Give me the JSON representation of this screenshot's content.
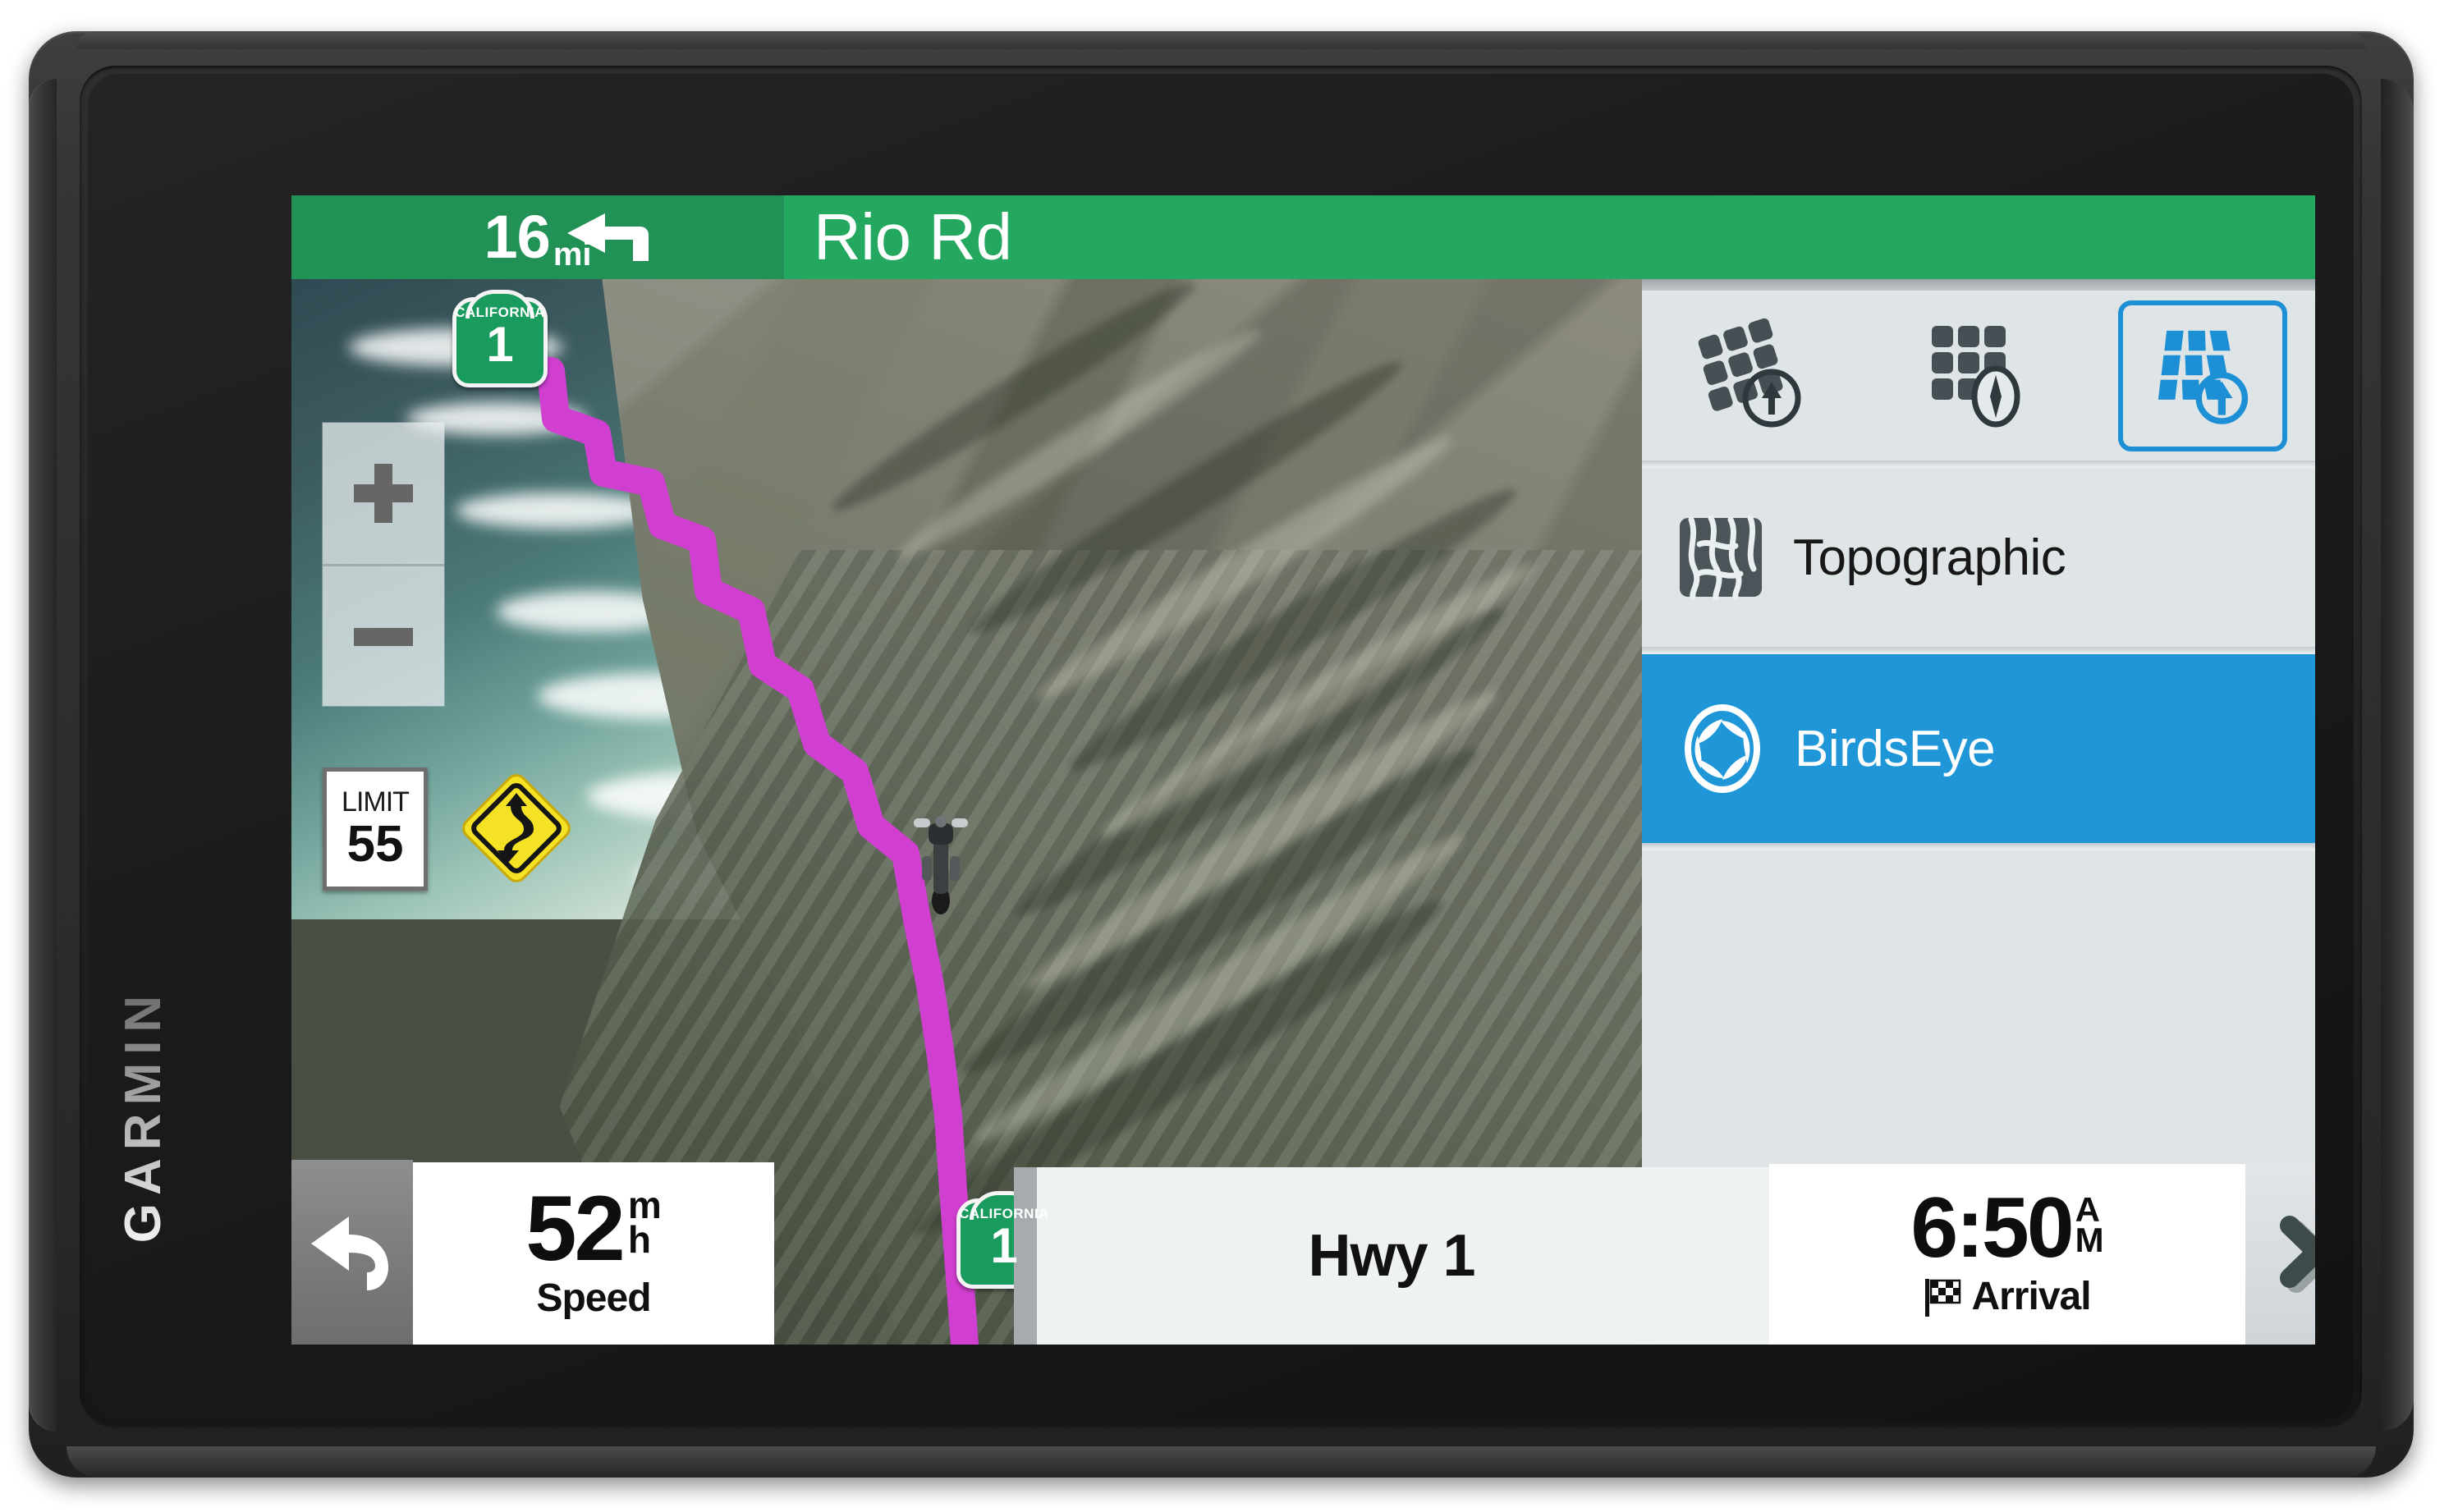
{
  "device": {
    "brand": "GARMIN"
  },
  "nav_header": {
    "distance_value": "16",
    "distance_unit": "mi",
    "turn_icon": "turn-left-arrow-icon",
    "street_name": "Rio Rd",
    "distance_bg": "#219156",
    "street_bg": "#24a85f"
  },
  "map": {
    "route_color": "#d13fd1",
    "vehicle_icon": "motorcycle-position-icon",
    "shields": [
      {
        "state": "CALIFORNIA",
        "number": "1"
      },
      {
        "state": "CALIFORNIA",
        "number": "1"
      }
    ],
    "zoom_in_icon": "plus-icon",
    "zoom_out_icon": "minus-icon",
    "speed_limit": {
      "label": "LIMIT",
      "value": "55"
    },
    "warning_sign": {
      "icon": "winding-road-warning-icon",
      "fill": "#f5e224"
    }
  },
  "map_style_panel": {
    "orientation_buttons": [
      {
        "icon": "map-3d-track-up-icon",
        "selected": false
      },
      {
        "icon": "map-2d-north-up-icon",
        "selected": false
      },
      {
        "icon": "map-2d-track-up-icon",
        "selected": true
      }
    ],
    "selected_color": "#1d8fd4",
    "rows": [
      {
        "icon": "topographic-contour-icon",
        "label": "Topographic",
        "selected": false
      },
      {
        "icon": "birdseye-aperture-icon",
        "label": "BirdsEye",
        "selected": true
      }
    ],
    "highlight_color": "#1e96d7"
  },
  "bottom_bar": {
    "back_icon": "back-arrow-icon",
    "speed": {
      "value": "52",
      "unit_top": "m",
      "unit_bottom": "h",
      "caption": "Speed"
    },
    "road_label": "Hwy 1",
    "arrival": {
      "time": "6:50",
      "ampm_top": "A",
      "ampm_bottom": "M",
      "caption": "Arrival",
      "icon": "checkered-flag-icon"
    },
    "close_icon": "close-x-icon"
  }
}
